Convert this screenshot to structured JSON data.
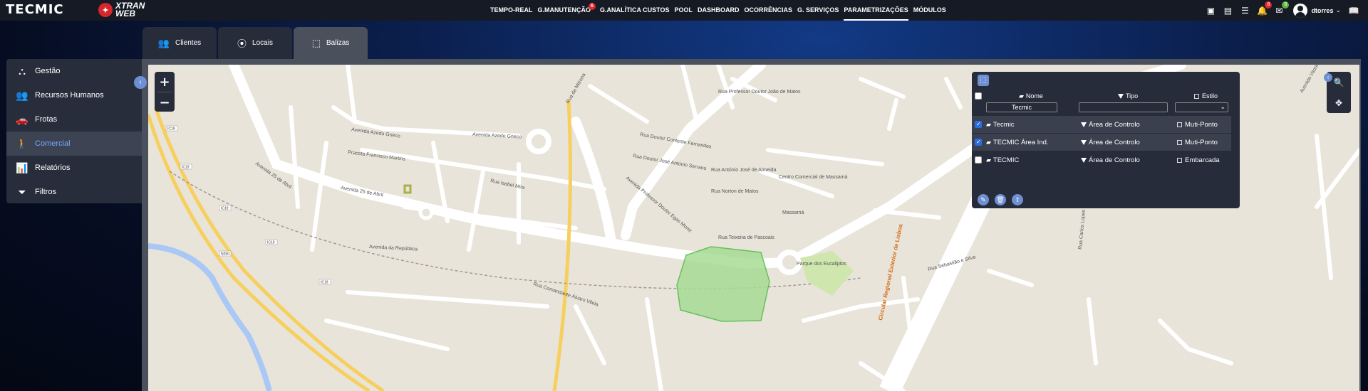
{
  "brand": {
    "logo": "TECMIC",
    "product_line1": "XTRAN",
    "product_line2": "WEB"
  },
  "nav": [
    {
      "label": "TEMPO-REAL"
    },
    {
      "label": "G.MANUTENÇÃO",
      "badge": "6"
    },
    {
      "label": "G.ANALÍTICA CUSTOS"
    },
    {
      "label": "POOL"
    },
    {
      "label": "DASHBOARD"
    },
    {
      "label": "OCORRÊNCIAS"
    },
    {
      "label": "G. SERVIÇOS"
    },
    {
      "label": "PARAMETRIZAÇÕES",
      "active": true
    },
    {
      "label": "MÓDULOS"
    }
  ],
  "header_icons": {
    "alerts_count": "8",
    "messages_count": "6"
  },
  "user": {
    "name": "dtorres"
  },
  "tabs": [
    {
      "label": "Clientes",
      "icon": "users-icon"
    },
    {
      "label": "Locais",
      "icon": "location-pin-icon"
    },
    {
      "label": "Balizas",
      "icon": "square-dashed-icon",
      "active": true
    }
  ],
  "sidebar": {
    "items": [
      {
        "label": "Gestão",
        "icon": "hierarchy-icon"
      },
      {
        "label": "Recursos Humanos",
        "icon": "people-icon"
      },
      {
        "label": "Frotas",
        "icon": "cars-icon"
      },
      {
        "label": "Comercial",
        "icon": "walking-icon",
        "active": true
      },
      {
        "label": "Relatórios",
        "icon": "report-icon"
      },
      {
        "label": "Filtros",
        "icon": "filter-gear-icon"
      }
    ]
  },
  "panel": {
    "headers": {
      "nome": "Nome",
      "tipo": "Tipo",
      "estilo": "Estilo"
    },
    "filter_nome": "Tecmic",
    "filter_tipo": "",
    "rows": [
      {
        "checked": true,
        "nome": "Tecmic",
        "tipo": "Área de Controlo",
        "estilo": "Muti-Ponto",
        "highlight": true
      },
      {
        "checked": true,
        "nome": "TECMIC Área Ind.",
        "tipo": "Área de Controlo",
        "estilo": "Muti-Ponto",
        "highlight": true
      },
      {
        "checked": false,
        "nome": "TECMIC",
        "tipo": "Área de Controlo",
        "estilo": "Embarcada",
        "highlight": false
      }
    ]
  },
  "map_labels": {
    "streets": [
      "Avenida Azedo Gneco",
      "Avenida Azedo Gneco",
      "Praceta Francisco Martins",
      "Avenida 25 de Abril",
      "Avenida 25 de Abril",
      "Rua Isabel Mira",
      "Avenida da República",
      "Rua Comandante Álvaro Vilela",
      "Rua da Mitrena",
      "Avenida Professor Doutor Egas Moniz",
      "Rua Doutor Contente Fernandes",
      "Rua Doutor José António Serrano",
      "Rua Norton de Matos",
      "Rua Teixeira de Pascoais",
      "Rua Professor Doutor João de Matos",
      "Rua António José de Almeida",
      "Circular Regional Exterior de Lisboa",
      "Rua Carlos Lopes",
      "Rua Sebastião e Silva",
      "Avenida Vitorino Nemésio"
    ],
    "places": [
      "Parque dos Eucaliptos",
      "Centro Comercial de Massamá",
      "Massamá"
    ],
    "road_shields": [
      "IC19",
      "IC19",
      "IC19",
      "IC19",
      "IC19",
      "N250"
    ]
  },
  "colors": {
    "topbar": "#151a24",
    "accent": "#6e8fd1",
    "panel": "#262c3a",
    "map_bg": "#e9e4da",
    "geofence": "#7fd27a",
    "highway": "#f6cf5e"
  }
}
